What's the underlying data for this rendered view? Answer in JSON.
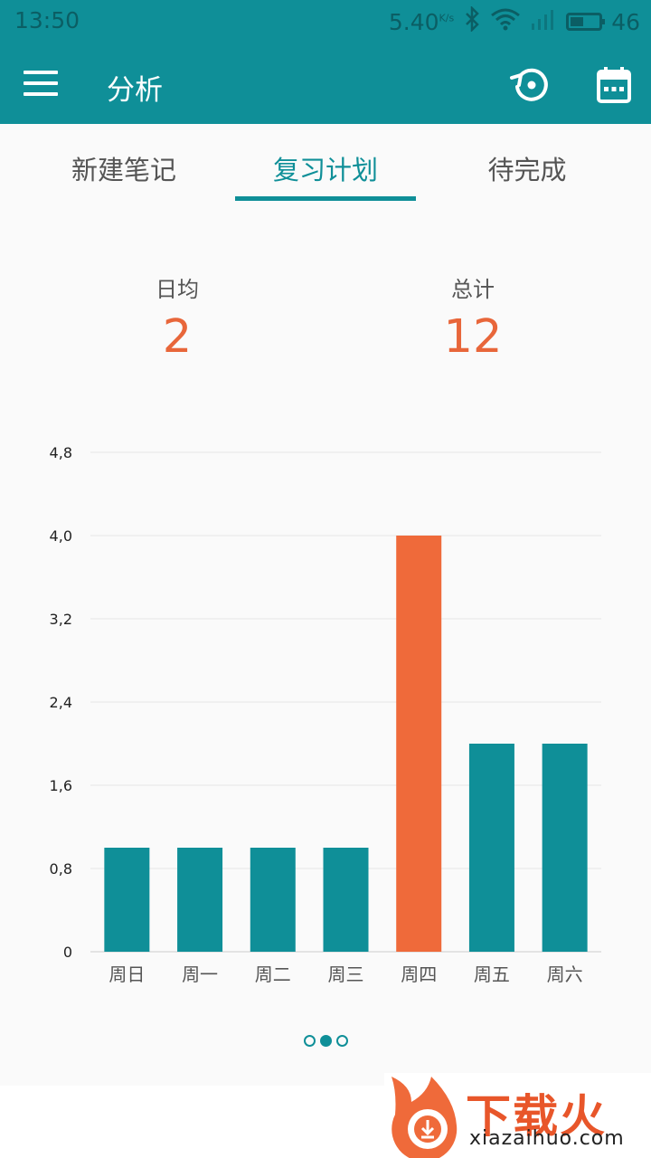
{
  "status_bar": {
    "time": "13:50",
    "speed_value": "5.40",
    "speed_unit": "K/s",
    "battery_level": "46"
  },
  "app_bar": {
    "title": "分析",
    "icons": [
      "menu-icon",
      "history-icon",
      "calendar-icon"
    ]
  },
  "tabs": [
    {
      "label": "新建笔记",
      "active": false
    },
    {
      "label": "复习计划",
      "active": true
    },
    {
      "label": "待完成",
      "active": false
    }
  ],
  "stats": {
    "daily_avg_label": "日均",
    "daily_avg_value": "2",
    "total_label": "总计",
    "total_value": "12"
  },
  "chart_data": {
    "type": "bar",
    "categories": [
      "周日",
      "周一",
      "周二",
      "周三",
      "周四",
      "周五",
      "周六"
    ],
    "values": [
      1,
      1,
      1,
      1,
      4,
      2,
      2
    ],
    "highlight_index": 4,
    "y_ticks": [
      "0",
      "0,8",
      "1,6",
      "2,4",
      "3,2",
      "4,0",
      "4,8"
    ],
    "ylim": [
      0,
      4.8
    ],
    "grid": true,
    "colors": {
      "bar": "#0f8f98",
      "highlight": "#ef6a3a"
    }
  },
  "pager": {
    "pages": 3,
    "active_index": 1
  },
  "watermark": {
    "text": "下载火",
    "sub": "xiazaihuo.com"
  },
  "colors": {
    "primary": "#0f8f98",
    "accent": "#e8663a"
  }
}
